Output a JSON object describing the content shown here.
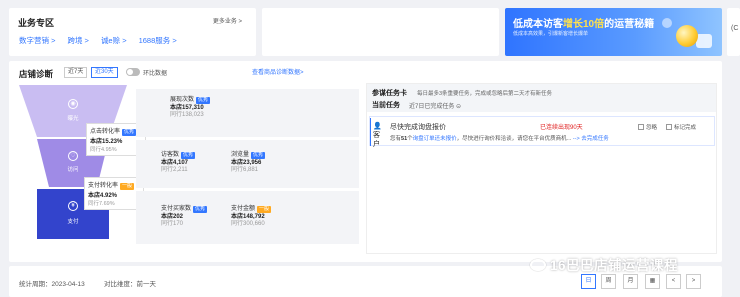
{
  "services": {
    "title": "业务专区",
    "more": "更多业务 >",
    "links": [
      "数字营销 >",
      "跨境 >",
      "诚e赊 >",
      "1688服务 >"
    ]
  },
  "banner": {
    "headline_pre": "低成本访客",
    "headline_hl": "增长10倍",
    "headline_post": "的运营秘籍",
    "sub": "低成本高效果，引爆新客增长爆单"
  },
  "side": {
    "partial": "(C"
  },
  "diagnosis": {
    "title": "店铺诊断",
    "range_tabs": [
      "近7天",
      "近30天"
    ],
    "compare_toggle": "环比数据",
    "view_link": "查看商品诊断数据>",
    "funnel": [
      {
        "label": "曝光",
        "icon": "◉"
      },
      {
        "label": "访问",
        "icon": "♡"
      },
      {
        "label": "支付",
        "icon": "¥"
      }
    ],
    "rates": [
      {
        "name": "点击转化率",
        "tag": "优秀",
        "value": "本店15.23%",
        "peer": "同行4.95%"
      },
      {
        "name": "支付转化率",
        "tag": "一般",
        "value": "本店4.92%",
        "peer": "同行7.69%"
      }
    ],
    "metrics": [
      {
        "name": "展现次数",
        "tag": "优秀",
        "value": "本店157,310",
        "peer": "同行138,023"
      },
      {
        "name": "访客数",
        "tag": "优秀",
        "value": "本店4,107",
        "peer": "同行2,211"
      },
      {
        "name": "浏览量",
        "tag": "优秀",
        "value": "本店23,956",
        "peer": "同行6,881"
      },
      {
        "name": "支付买家数",
        "tag": "优秀",
        "value": "本店202",
        "peer": "同行170"
      },
      {
        "name": "支付金额",
        "tag": "一般",
        "value": "本店148,792",
        "peer": "同行300,660"
      }
    ]
  },
  "tasks": {
    "title": "参谋任务卡",
    "subtitle": "每日最多3条重要任务，完成或忽略后第二天才有新任务",
    "current_title": "当前任务",
    "current_sub": "近7日已完成任务",
    "item": {
      "customer": "客户",
      "name": "尽快完成询盘报价",
      "status": "已连续出现90天",
      "desc_pre": "您有",
      "desc_count": "51",
      "desc_mid": "个",
      "desc_link": "询盘订单还未报价",
      "desc_post": "，尽快进行询价和洽谈，请您在平台优质商机... ",
      "go": "--> 去完成任务",
      "ignore": "忽略",
      "mark_done": "标记完成"
    }
  },
  "footer": {
    "date": "统计周期：2023-04-13",
    "compare": "对比维度：前一天",
    "buttons": [
      "日",
      "周",
      "月",
      "▦",
      "<",
      ">"
    ]
  },
  "watermark": "16巴巴店铺运营课程"
}
